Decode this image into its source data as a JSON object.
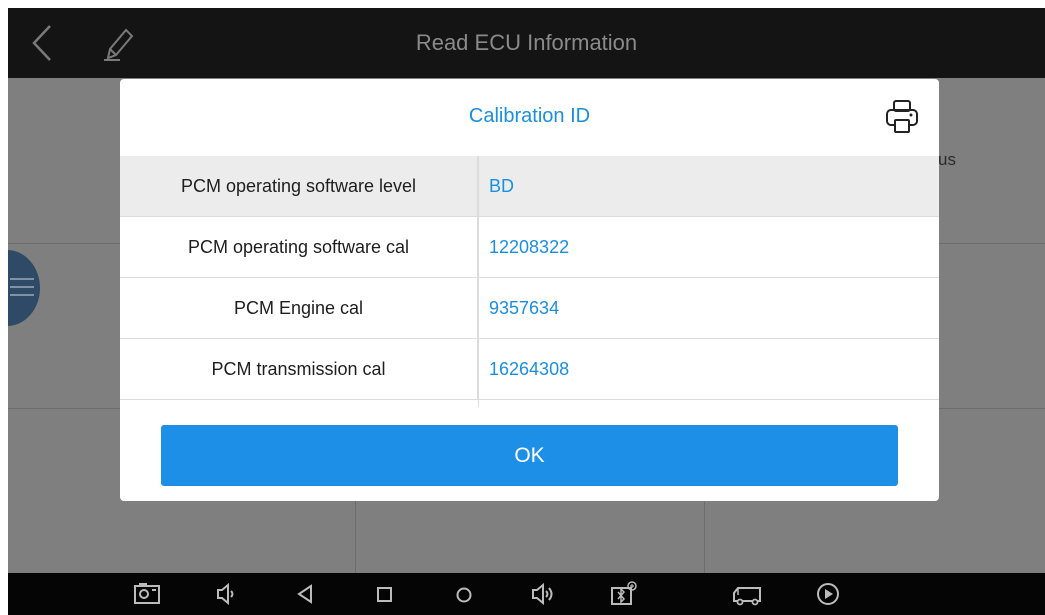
{
  "header": {
    "title": "Read ECU Information"
  },
  "background": {
    "partial_status_text": "us"
  },
  "dialog": {
    "title": "Calibration ID",
    "rows": [
      {
        "label": "PCM operating software level",
        "value": "BD"
      },
      {
        "label": "PCM operating software cal",
        "value": "12208322"
      },
      {
        "label": "PCM Engine cal",
        "value": "9357634"
      },
      {
        "label": "PCM transmission cal",
        "value": "16264308"
      }
    ],
    "ok_label": "OK"
  },
  "icons": {
    "back": "back-arrow-icon",
    "edit": "pencil-icon",
    "print": "printer-icon",
    "menu": "hamburger-menu-icon",
    "nav": [
      "screenshot-icon",
      "volume-down-icon",
      "nav-back-icon",
      "nav-recent-icon",
      "nav-home-icon",
      "volume-up-icon",
      "vci-bluetooth-icon",
      "truck-icon",
      "play-icon"
    ]
  },
  "colors": {
    "accent": "#1a8fdf",
    "button": "#1e8fe6",
    "topbar": "#141414",
    "navbar": "#050505",
    "overlay": "#7f7f7f"
  }
}
